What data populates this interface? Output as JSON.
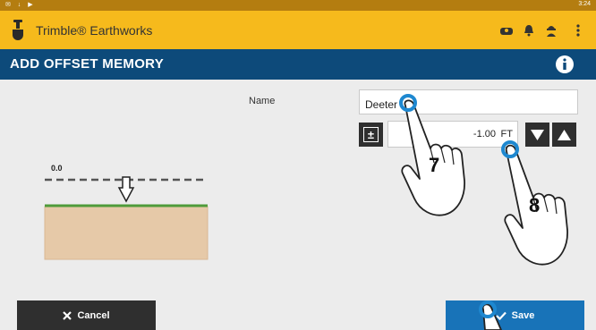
{
  "status_bar": {
    "time": "3:24",
    "icons": [
      "notification-icon",
      "download-icon",
      "play-icon"
    ]
  },
  "app_bar": {
    "title": "Trimble® Earthworks",
    "icons": [
      "machine-icon",
      "alarm-bell-icon",
      "operator-icon",
      "more-vertical-icon"
    ]
  },
  "page": {
    "title": "ADD OFFSET MEMORY",
    "info_icon": "info-icon"
  },
  "form": {
    "name_label": "Name",
    "name_value": "Deeter",
    "offset_value": "-1.00",
    "offset_unit": "FT",
    "plus_minus_label": "±"
  },
  "diagram": {
    "elevation_label": "0.0"
  },
  "buttons": {
    "cancel": "Cancel",
    "save": "Save"
  },
  "annotations": {
    "step_7": "7",
    "step_8": "8"
  },
  "colors": {
    "status_bar": "#b47d10",
    "app_bar": "#f6ba1c",
    "title_bar": "#0d4a7a",
    "save_button": "#1873b8",
    "dark_button": "#2f2f2f",
    "ground_line": "#4f9b3a",
    "soil": "#e6c9a8",
    "touch_ring": "#1e88d0"
  }
}
